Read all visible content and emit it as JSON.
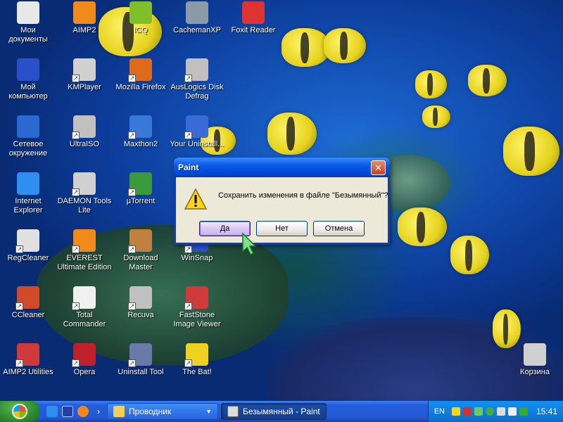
{
  "desktop": {
    "icons": [
      {
        "label": "Мои документы",
        "icon": "my-documents-icon"
      },
      {
        "label": "AIMP2",
        "icon": "aimp2-icon"
      },
      {
        "label": "ICQ",
        "icon": "icq-icon"
      },
      {
        "label": "CachemanXP",
        "icon": "cachemanxp-icon"
      },
      {
        "label": "Foxit Reader",
        "icon": "foxit-reader-icon"
      },
      {
        "label": "Мой компьютер",
        "icon": "my-computer-icon"
      },
      {
        "label": "KMPlayer",
        "icon": "kmplayer-icon"
      },
      {
        "label": "Mozilla Firefox",
        "icon": "firefox-icon"
      },
      {
        "label": "AusLogics Disk Defrag",
        "icon": "auslogics-defrag-icon"
      },
      {
        "label": "Сетевое окружение",
        "icon": "network-icon"
      },
      {
        "label": "UltraISO",
        "icon": "ultraiso-icon"
      },
      {
        "label": "Maxthon2",
        "icon": "maxthon-icon"
      },
      {
        "label": "Your Uninstall...",
        "icon": "your-uninstaller-icon"
      },
      {
        "label": "Internet Explorer",
        "icon": "internet-explorer-icon"
      },
      {
        "label": "DAEMON Tools Lite",
        "icon": "daemon-tools-icon"
      },
      {
        "label": "µTorrent",
        "icon": "utorrent-icon"
      },
      {
        "label": "RegCleaner",
        "icon": "regcleaner-icon"
      },
      {
        "label": "EVEREST Ultimate Edition",
        "icon": "everest-icon"
      },
      {
        "label": "Download Master",
        "icon": "download-master-icon"
      },
      {
        "label": "WinSnap",
        "icon": "winsnap-icon"
      },
      {
        "label": "CCleaner",
        "icon": "ccleaner-icon"
      },
      {
        "label": "Total Commander",
        "icon": "total-commander-icon"
      },
      {
        "label": "Recuva",
        "icon": "recuva-icon"
      },
      {
        "label": "FastStone Image Viewer",
        "icon": "faststone-icon"
      },
      {
        "label": "AIMP2 Utilities",
        "icon": "aimp2-utilities-icon"
      },
      {
        "label": "Opera",
        "icon": "opera-icon"
      },
      {
        "label": "Uninstall Tool",
        "icon": "uninstall-tool-icon"
      },
      {
        "label": "The Bat!",
        "icon": "the-bat-icon"
      },
      {
        "label": "Корзина",
        "icon": "recycle-bin-icon"
      }
    ]
  },
  "dialog": {
    "title": "Paint",
    "close_glyph": "✕",
    "message": "Сохранить изменения в файле \"Безымянный\"?",
    "buttons": {
      "yes": "Да",
      "no": "Нет",
      "cancel": "Отмена"
    }
  },
  "taskbar": {
    "quicklaunch_more": "›",
    "explorer_label": "Проводник",
    "explorer_dropdown": "▼",
    "paint_label": "Безымянный - Paint"
  },
  "tray": {
    "language": "EN",
    "clock": "15:41"
  },
  "colors": {
    "title_bar": "#0a5ae4",
    "dialog_body": "#ece9d8",
    "taskbar": "#245edb",
    "start_button": "#2e8b2e"
  }
}
